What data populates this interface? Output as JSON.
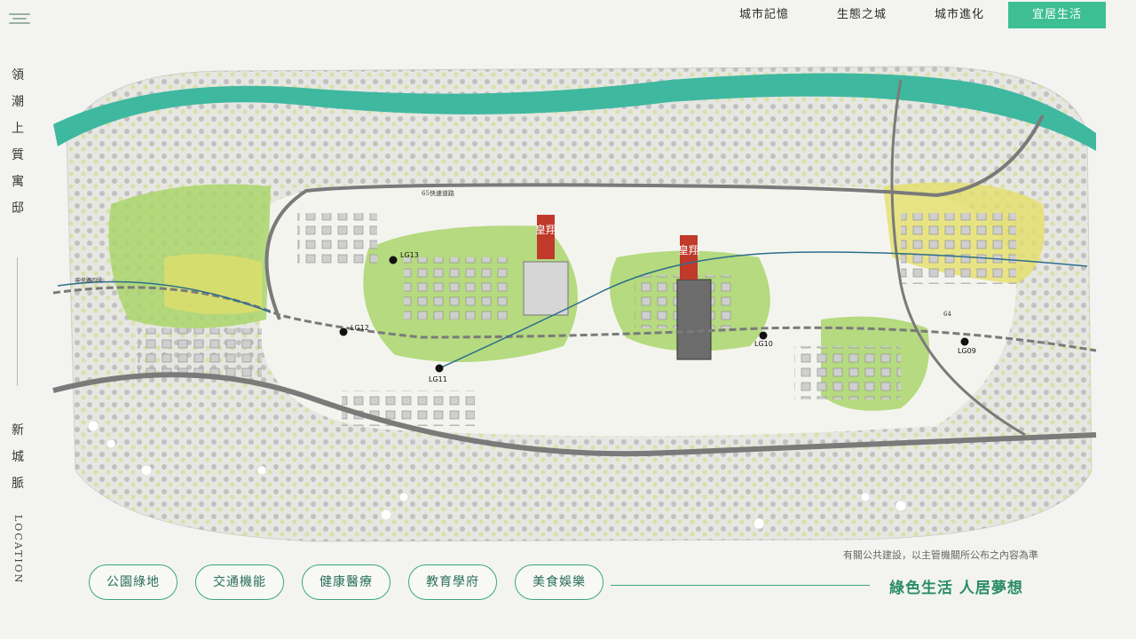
{
  "nav": {
    "items": [
      "城市記憶",
      "生態之城",
      "城市進化",
      "宜居生活"
    ],
    "active_index": 3
  },
  "sidebar": {
    "top_chars": [
      "領",
      "潮",
      "上",
      "質",
      "寓",
      "邸"
    ],
    "bottom_chars": [
      "新",
      "城",
      "脈"
    ],
    "location": "LOCATION"
  },
  "map": {
    "tower_labels": [
      "皇翔",
      "皇翔"
    ],
    "stations": [
      "LG13",
      "LG12",
      "LG11",
      "LG10",
      "LG09"
    ],
    "road_labels": [
      "65快速道路",
      "64",
      "中央路四段"
    ],
    "colors": {
      "river": "#3fb8a0",
      "park": "#a9d56b",
      "highlight": "#e5df6a",
      "road": "#7a7a7a",
      "tower_label": "#c0392b"
    }
  },
  "disclaimer": "有關公共建設，以主管機關所公布之內容為準",
  "categories": [
    "公園綠地",
    "交通機能",
    "健康醫療",
    "教育學府",
    "美食娛樂"
  ],
  "tagline": "綠色生活 人居夢想",
  "colors": {
    "accent": "#3dbf93",
    "border": "#3aa57f"
  }
}
